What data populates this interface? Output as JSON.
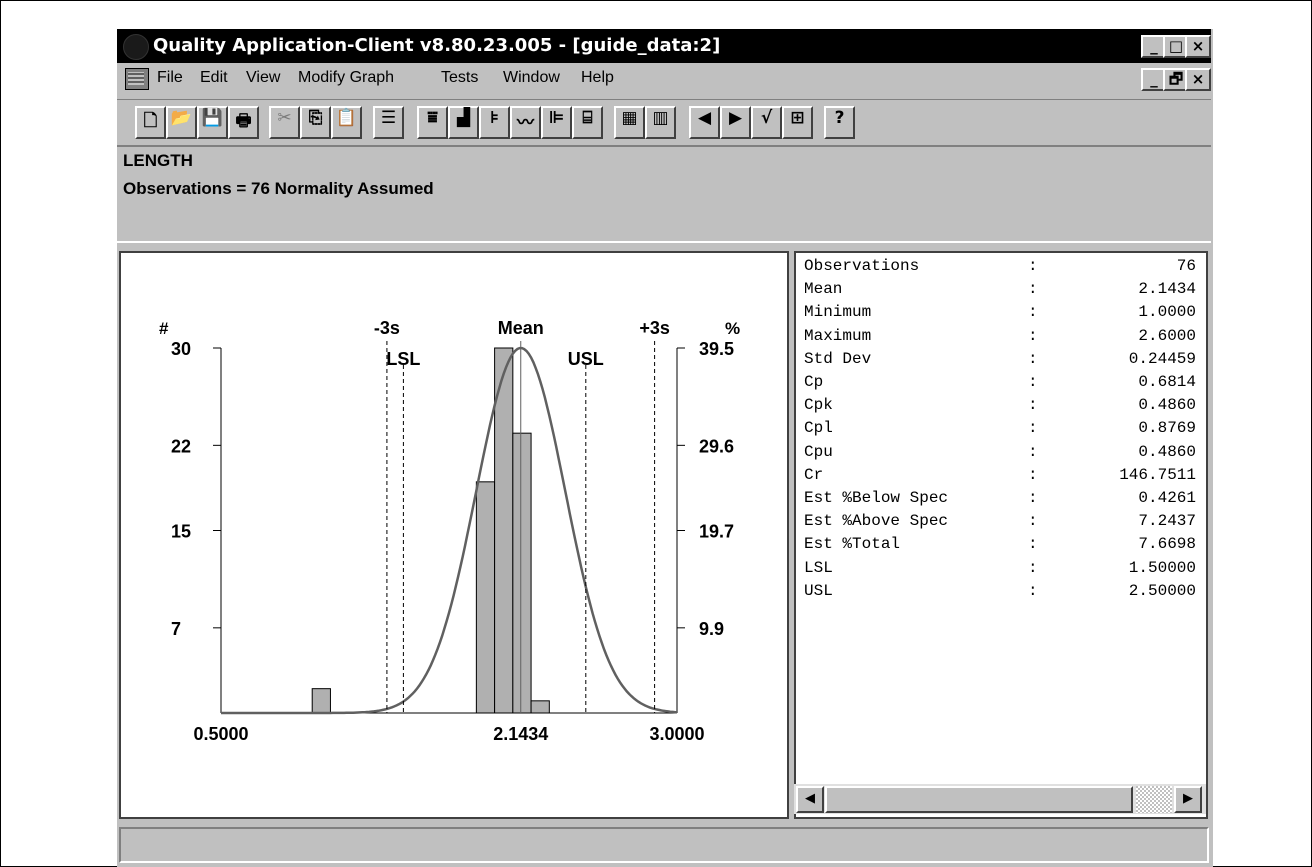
{
  "window": {
    "title": "Quality Application-Client v8.80.23.005 - [guide_data:2]",
    "title_buttons": [
      "_",
      "□",
      "×"
    ],
    "child_buttons": [
      "_",
      "🗗",
      "×"
    ]
  },
  "menu": [
    "File",
    "Edit",
    "View",
    "Modify Graph",
    "Tests",
    "Window",
    "Help"
  ],
  "toolbar": {
    "buttons": [
      {
        "name": "new-icon",
        "glyph": "🗋"
      },
      {
        "name": "open-icon",
        "glyph": "📂"
      },
      {
        "name": "save-icon",
        "glyph": "💾"
      },
      {
        "name": "print-icon",
        "glyph": "🖶"
      },
      {
        "name": "cut-icon",
        "glyph": "✂"
      },
      {
        "name": "copy-icon",
        "glyph": "⎘"
      },
      {
        "name": "paste-icon",
        "glyph": "📋"
      },
      {
        "name": "report-icon",
        "glyph": "☰"
      },
      {
        "name": "xbar-chart-icon",
        "glyph": "⩸"
      },
      {
        "name": "histogram-icon",
        "glyph": "▟"
      },
      {
        "name": "pareto-icon",
        "glyph": "⊧"
      },
      {
        "name": "trend-icon",
        "glyph": "〰"
      },
      {
        "name": "capability-icon",
        "glyph": "⊫"
      },
      {
        "name": "box-icon",
        "glyph": "⌸"
      },
      {
        "name": "grid-icon",
        "glyph": "▦"
      },
      {
        "name": "columns-icon",
        "glyph": "▥"
      },
      {
        "name": "prev-icon",
        "glyph": "◀"
      },
      {
        "name": "next-icon",
        "glyph": "▶"
      },
      {
        "name": "check-icon",
        "glyph": "√"
      },
      {
        "name": "layout-icon",
        "glyph": "⊞"
      },
      {
        "name": "help-icon",
        "glyph": "?"
      }
    ]
  },
  "info": {
    "variable": "LENGTH",
    "summary": "Observations = 76  Normality Assumed"
  },
  "stats": [
    {
      "name": "Observations",
      "value": "76"
    },
    {
      "name": "Mean",
      "value": "2.1434"
    },
    {
      "name": "Minimum",
      "value": "1.0000"
    },
    {
      "name": "Maximum",
      "value": "2.6000"
    },
    {
      "name": "Std Dev",
      "value": "0.24459"
    },
    {
      "name": "Cp",
      "value": "0.6814"
    },
    {
      "name": "Cpk",
      "value": "0.4860"
    },
    {
      "name": "Cpl",
      "value": "0.8769"
    },
    {
      "name": "Cpu",
      "value": "0.4860"
    },
    {
      "name": "Cr",
      "value": "146.7511"
    },
    {
      "name": "Est %Below Spec",
      "value": "0.4261"
    },
    {
      "name": "Est %Above Spec",
      "value": "7.2437"
    },
    {
      "name": "Est %Total",
      "value": "7.6698"
    },
    {
      "name": "LSL",
      "value": "1.50000"
    },
    {
      "name": "USL",
      "value": "2.50000"
    }
  ],
  "scroll": {
    "left": "◀",
    "right": "▶"
  },
  "chart_data": {
    "type": "bar",
    "left_axis_label": "#",
    "right_axis_label": "%",
    "left_ticks": [
      "30",
      "22",
      "15",
      "7"
    ],
    "right_ticks": [
      "39.5",
      "29.6",
      "19.7",
      "9.9"
    ],
    "x_ticks": [
      "0.5000",
      "2.1434",
      "3.0000"
    ],
    "xlim": [
      0.5,
      3.0
    ],
    "ylim": [
      0,
      30
    ],
    "bins": [
      {
        "x0": 1.0,
        "x1": 1.1,
        "count": 2
      },
      {
        "x0": 1.9,
        "x1": 2.0,
        "count": 19
      },
      {
        "x0": 2.0,
        "x1": 2.1,
        "count": 30
      },
      {
        "x0": 2.1,
        "x1": 2.2,
        "count": 23
      },
      {
        "x0": 2.2,
        "x1": 2.3,
        "count": 1
      }
    ],
    "reference_lines": [
      {
        "label": "-3s",
        "value": 1.4096,
        "style": "dashed",
        "pos": "top"
      },
      {
        "label": "LSL",
        "value": 1.5,
        "style": "dashed",
        "pos": "low"
      },
      {
        "label": "Mean",
        "value": 2.1434,
        "style": "solid",
        "pos": "top"
      },
      {
        "label": "USL",
        "value": 2.5,
        "style": "dashed",
        "pos": "low"
      },
      {
        "label": "+3s",
        "value": 2.8772,
        "style": "dashed",
        "pos": "top"
      }
    ],
    "normal_curve": {
      "mean": 2.1434,
      "std_dev": 0.24459
    },
    "grid": false
  }
}
